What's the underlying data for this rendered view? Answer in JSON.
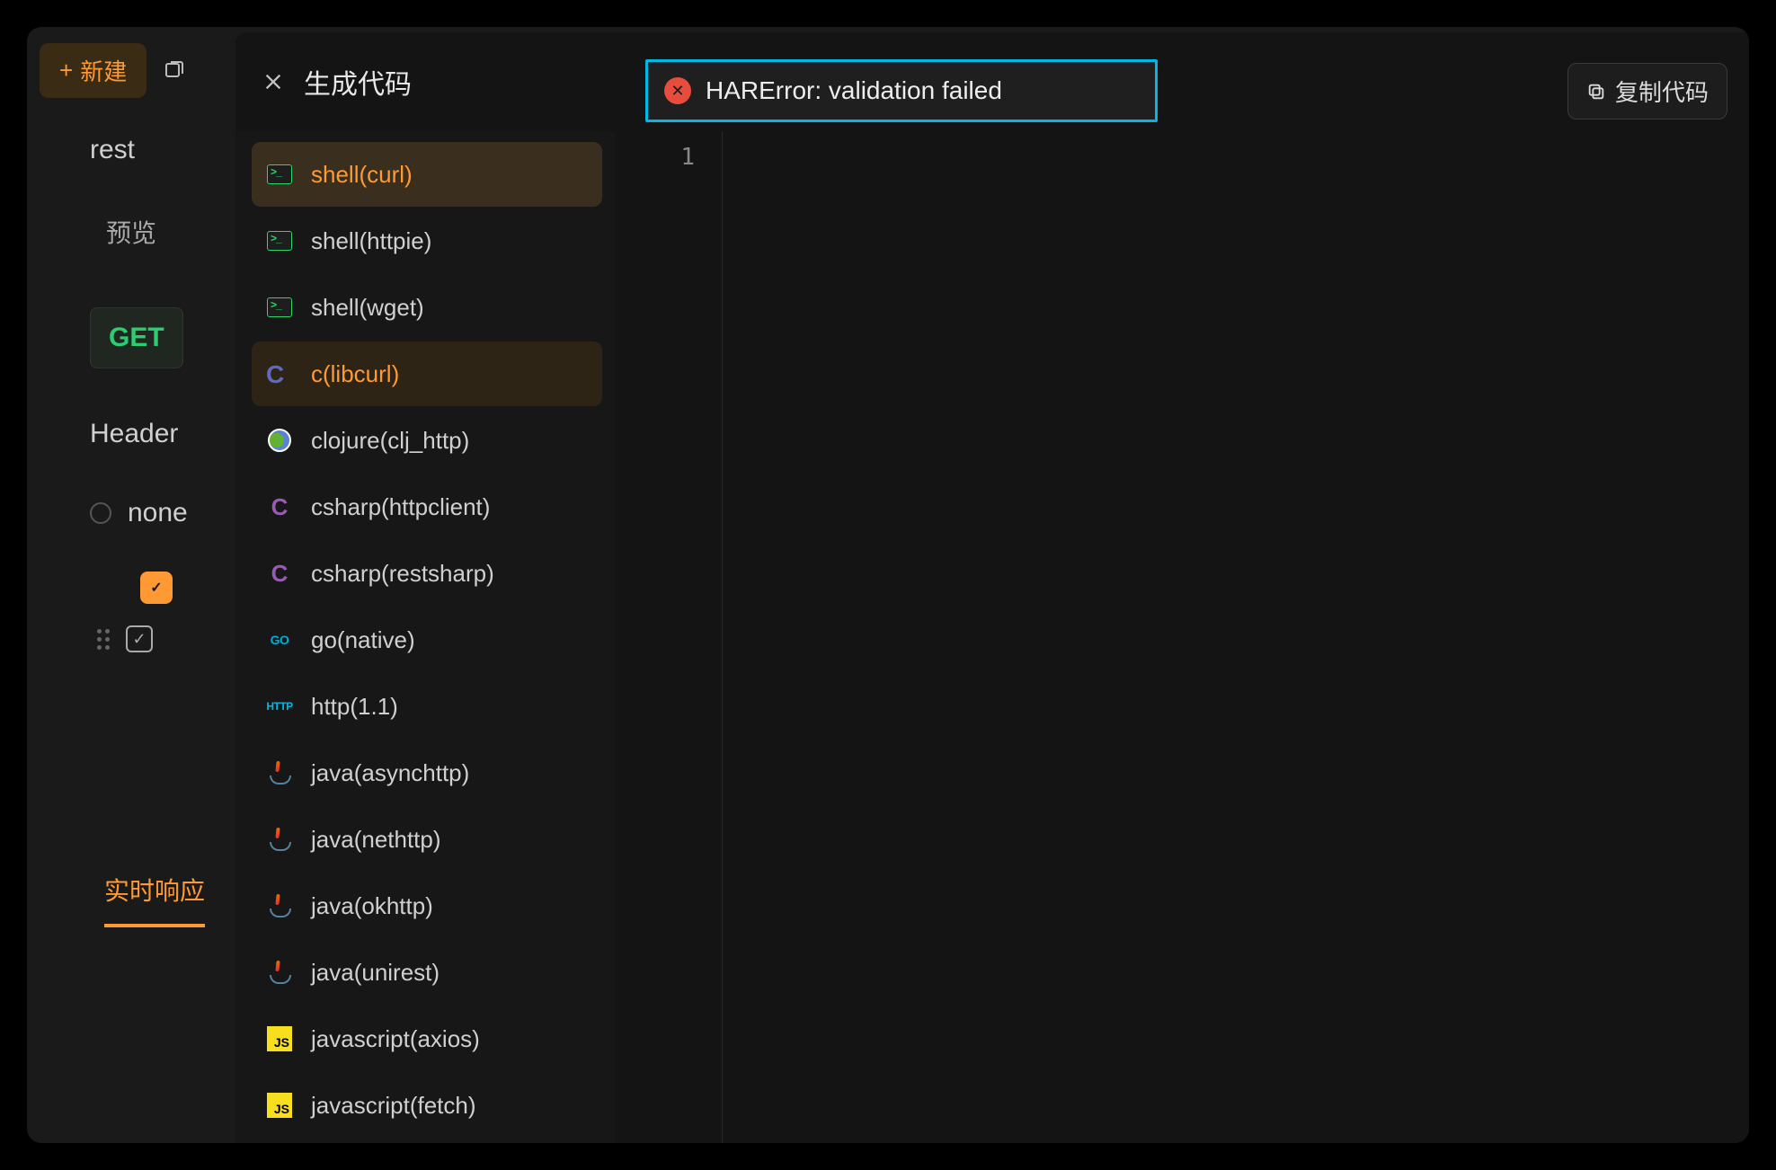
{
  "bg": {
    "new_label": "新建",
    "rest": "rest",
    "preview": "预览",
    "method": "GET",
    "header": "Header",
    "none": "none",
    "live_response": "实时响应"
  },
  "modal": {
    "title": "生成代码",
    "error": "HARError: validation failed",
    "copy_label": "复制代码",
    "line_number": "1"
  },
  "languages": [
    {
      "label": "shell(curl)",
      "icon": "term",
      "state": "active"
    },
    {
      "label": "shell(httpie)",
      "icon": "term",
      "state": ""
    },
    {
      "label": "shell(wget)",
      "icon": "term",
      "state": ""
    },
    {
      "label": "c(libcurl)",
      "icon": "c",
      "state": "hover"
    },
    {
      "label": "clojure(clj_http)",
      "icon": "clojure",
      "state": ""
    },
    {
      "label": "csharp(httpclient)",
      "icon": "csharp",
      "state": ""
    },
    {
      "label": "csharp(restsharp)",
      "icon": "csharp",
      "state": ""
    },
    {
      "label": "go(native)",
      "icon": "go",
      "state": ""
    },
    {
      "label": "http(1.1)",
      "icon": "http",
      "state": ""
    },
    {
      "label": "java(asynchttp)",
      "icon": "java",
      "state": ""
    },
    {
      "label": "java(nethttp)",
      "icon": "java",
      "state": ""
    },
    {
      "label": "java(okhttp)",
      "icon": "java",
      "state": ""
    },
    {
      "label": "java(unirest)",
      "icon": "java",
      "state": ""
    },
    {
      "label": "javascript(axios)",
      "icon": "js",
      "state": ""
    },
    {
      "label": "javascript(fetch)",
      "icon": "js",
      "state": ""
    }
  ]
}
